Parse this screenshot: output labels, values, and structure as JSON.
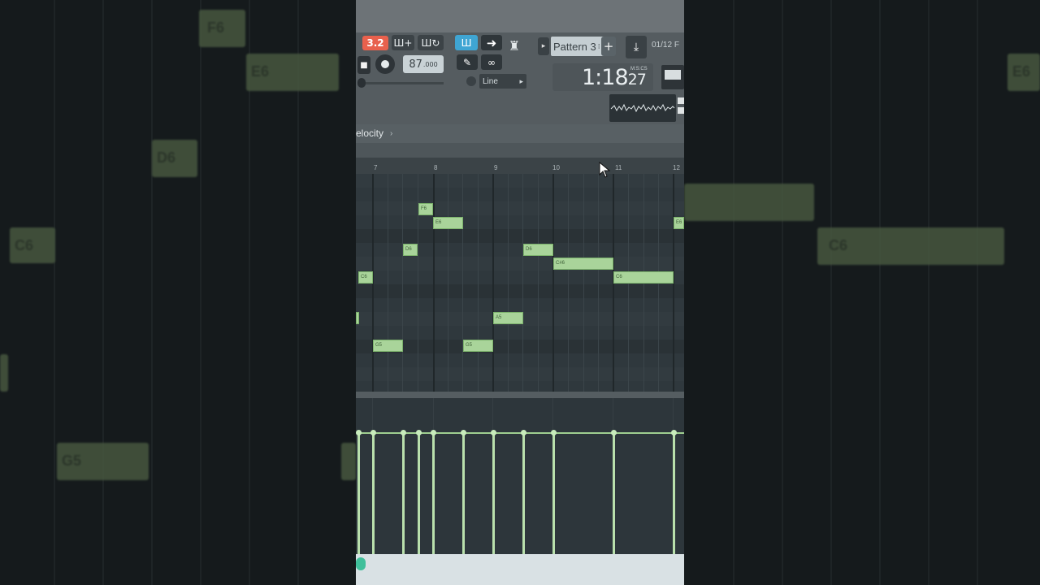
{
  "transport": {
    "record_badge": "3.2",
    "tempo_value": "87",
    "tempo_decimal": ".000"
  },
  "tools": {
    "snap_mode": "Line"
  },
  "pattern": {
    "name": "Pattern 3",
    "count": "01/12",
    "count_suffix": "F"
  },
  "time": {
    "display": "1:18",
    "seconds": "27",
    "unit": "M:S:CS"
  },
  "breadcrumb": {
    "label": "elocity",
    "arrow": "›"
  },
  "ruler": {
    "ticks": [
      "7",
      "8",
      "9",
      "10",
      "11",
      "12"
    ]
  },
  "notes": [
    {
      "label": "C6"
    },
    {
      "label": "G5"
    },
    {
      "label": "D6"
    },
    {
      "label": "F6"
    },
    {
      "label": "E6"
    },
    {
      "label": "G5"
    },
    {
      "label": "A5"
    },
    {
      "label": "D6"
    },
    {
      "label": "C#6"
    },
    {
      "label": "C6"
    },
    {
      "label": "E6"
    }
  ],
  "colors": {
    "note_fill": "#a9d49a",
    "grid_bg": "#2f383d",
    "record_badge": "#e8614d",
    "piano_roll_active": "#3fa5d3"
  },
  "side_labels": {
    "left": [
      "F6",
      "E6",
      "D6",
      "C6",
      "G5"
    ],
    "right": [
      "E6",
      "C6"
    ]
  }
}
